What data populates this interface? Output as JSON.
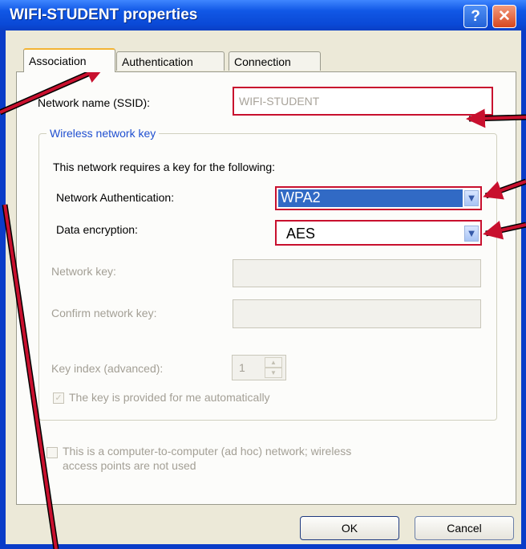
{
  "window": {
    "title": "WIFI-STUDENT properties",
    "help_glyph": "?",
    "close_glyph": "✕"
  },
  "tabs": [
    {
      "label": "Association"
    },
    {
      "label": "Authentication"
    },
    {
      "label": "Connection"
    }
  ],
  "association": {
    "ssid_label": "Network name (SSID):",
    "ssid_value": "WIFI-STUDENT",
    "group_title": "Wireless network key",
    "requires_text": "This network requires a key for the following:",
    "auth_label": "Network Authentication:",
    "auth_value": "WPA2",
    "encryption_label": "Data encryption:",
    "encryption_value": "AES",
    "network_key_label": "Network key:",
    "confirm_key_label": "Confirm network key:",
    "key_index_label": "Key index (advanced):",
    "key_index_value": "1",
    "auto_key_label": "The key is provided for me automatically",
    "adhoc_label_line1": "This is a computer-to-computer (ad hoc) network; wireless",
    "adhoc_label_line2": "access points are not used"
  },
  "buttons": {
    "ok": "OK",
    "cancel": "Cancel"
  },
  "colors": {
    "annotation": "#c8102e",
    "title_bar": "#0a49d6",
    "highlight": "#316ac5"
  }
}
